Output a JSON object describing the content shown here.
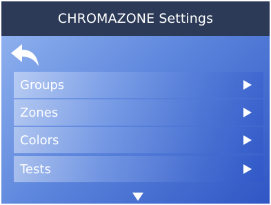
{
  "title": "CHROMAZONE Settings",
  "back_icon": "back-arrow-icon",
  "menu": {
    "items": [
      {
        "label": "Groups",
        "icon": "chevron-right-icon"
      },
      {
        "label": "Zones",
        "icon": "chevron-right-icon"
      },
      {
        "label": "Colors",
        "icon": "chevron-right-icon"
      },
      {
        "label": "Tests",
        "icon": "chevron-right-icon"
      }
    ]
  },
  "scroll_icon": "chevron-down-icon",
  "colors": {
    "titlebar": "#2c3a57",
    "background_start": "#8eb0ee",
    "background_end": "#2f56c4",
    "text": "#ffffff"
  }
}
